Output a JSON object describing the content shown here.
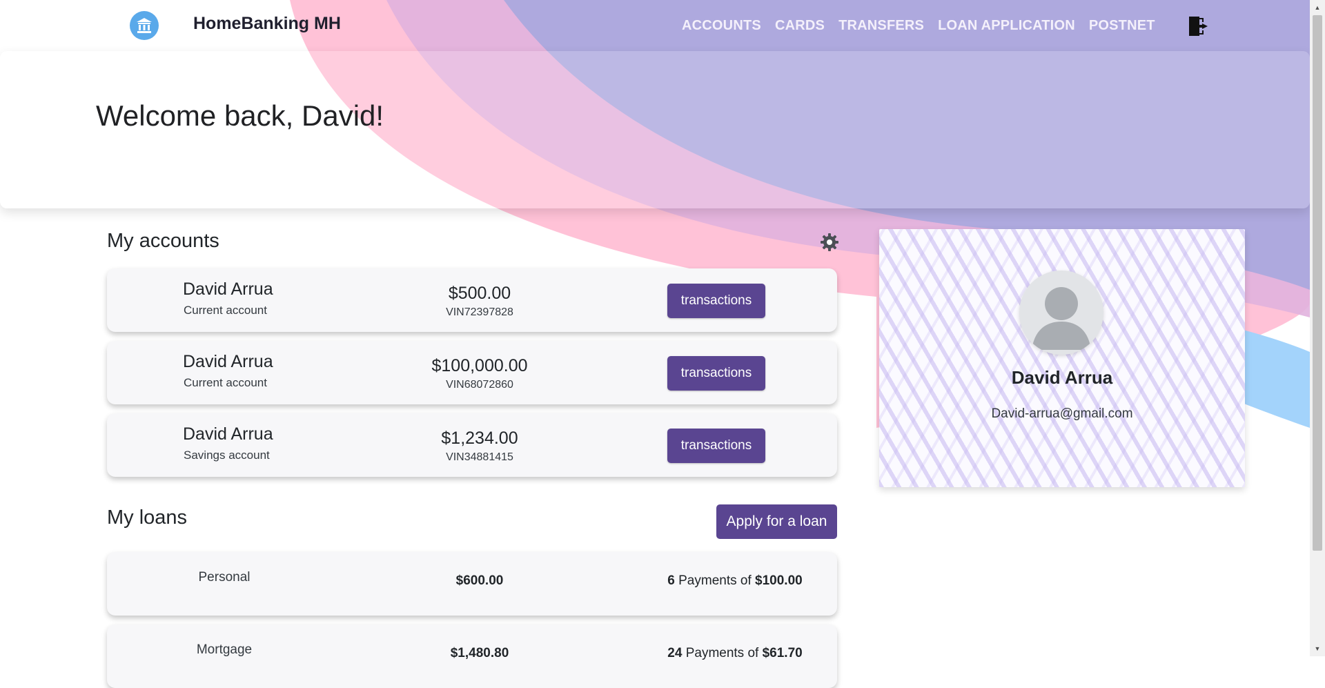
{
  "brand": {
    "name": "HomeBanking MH",
    "logo_icon": "bank-icon"
  },
  "nav": {
    "items": [
      {
        "label": "ACCOUNTS"
      },
      {
        "label": "CARDS"
      },
      {
        "label": "TRANSFERS"
      },
      {
        "label": "LOAN APPLICATION"
      },
      {
        "label": "POSTNET"
      }
    ],
    "logout_icon": "logout-icon"
  },
  "hero": {
    "greeting": "Welcome back, David!"
  },
  "accounts": {
    "title": "My accounts",
    "settings_icon": "gear-icon",
    "items": [
      {
        "owner": "David Arrua",
        "type": "Current account",
        "balance": "$500.00",
        "number": "VIN72397828",
        "button": "transactions"
      },
      {
        "owner": "David Arrua",
        "type": "Current account",
        "balance": "$100,000.00",
        "number": "VIN68072860",
        "button": "transactions"
      },
      {
        "owner": "David Arrua",
        "type": "Savings account",
        "balance": "$1,234.00",
        "number": "VIN34881415",
        "button": "transactions"
      }
    ]
  },
  "loans": {
    "title": "My loans",
    "apply_button": "Apply for a loan",
    "items": [
      {
        "type": "Personal",
        "amount": "$600.00",
        "payments": "6",
        "payments_text": " Payments of ",
        "payment_amount": "$100.00"
      },
      {
        "type": "Mortgage",
        "amount": "$1,480.80",
        "payments": "24",
        "payments_text": " Payments of ",
        "payment_amount": "$61.70"
      }
    ]
  },
  "profile": {
    "name": "David Arrua",
    "email": "David-arrua@gmail.com",
    "avatar_icon": "user-avatar-icon"
  },
  "colors": {
    "accent": "#5a4591",
    "logo": "#5aa9ea",
    "wave_pink": "#ffc2d7",
    "wave_purple": "#aea9de",
    "wave_blue": "#a3d3fb"
  }
}
